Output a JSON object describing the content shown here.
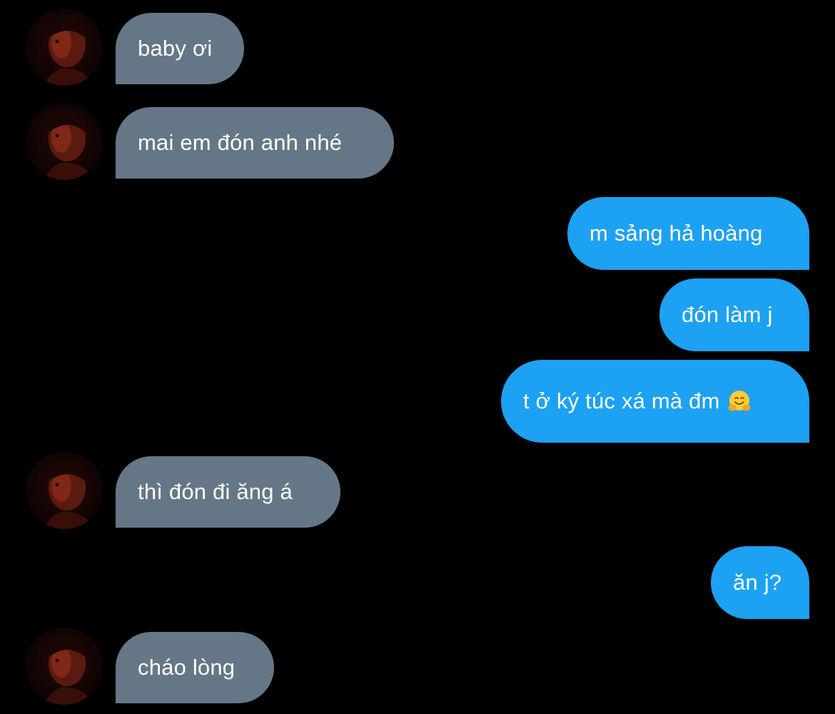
{
  "conversation": {
    "messages": [
      {
        "sender": "them",
        "text": "baby ơi"
      },
      {
        "sender": "them",
        "text": "mai em đón anh nhé"
      },
      {
        "sender": "me",
        "text": "m sảng hả hoàng"
      },
      {
        "sender": "me",
        "text": "đón làm j"
      },
      {
        "sender": "me",
        "text": "t ở ký túc xá mà đm",
        "emoji": "hugging-face-emoji"
      },
      {
        "sender": "them",
        "text": "thì đón đi ăng á"
      },
      {
        "sender": "me",
        "text": "ăn j?"
      },
      {
        "sender": "them",
        "text": "cháo lòng"
      }
    ]
  },
  "colors": {
    "background": "#000000",
    "incoming_bubble": "#657786",
    "outgoing_bubble": "#1da1f2",
    "text": "#ffffff"
  },
  "avatar": {
    "icon": "contact-avatar-photo"
  }
}
